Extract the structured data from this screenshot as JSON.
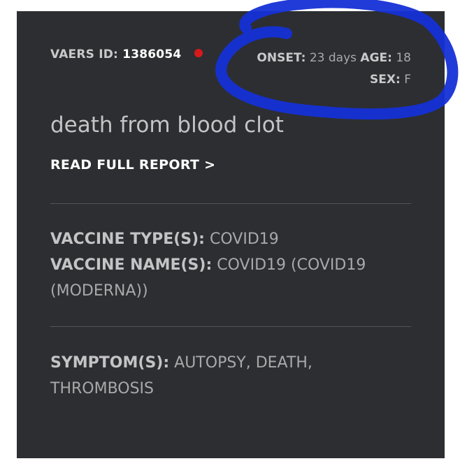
{
  "report": {
    "vaers_label": "VAERS ID:",
    "vaers_id": "1386054",
    "onset_label": "ONSET:",
    "onset_value": "23 days",
    "age_label": "AGE:",
    "age_value": "18",
    "sex_label": "SEX:",
    "sex_value": "F",
    "summary": "death from blood clot",
    "read_link": "READ FULL REPORT >",
    "vaccine_type_label": "VACCINE TYPE(S):",
    "vaccine_type_value": "COVID19",
    "vaccine_name_label": "VACCINE NAME(S):",
    "vaccine_name_value": "COVID19 (COVID19 (MODERNA))",
    "symptoms_label": "SYMPTOM(S):",
    "symptoms_value": "AUTOPSY, DEATH, THROMBOSIS"
  },
  "colors": {
    "card_background": "#2d2e31",
    "status_dot": "#d7191c",
    "annotation_circle": "#1530d6"
  }
}
